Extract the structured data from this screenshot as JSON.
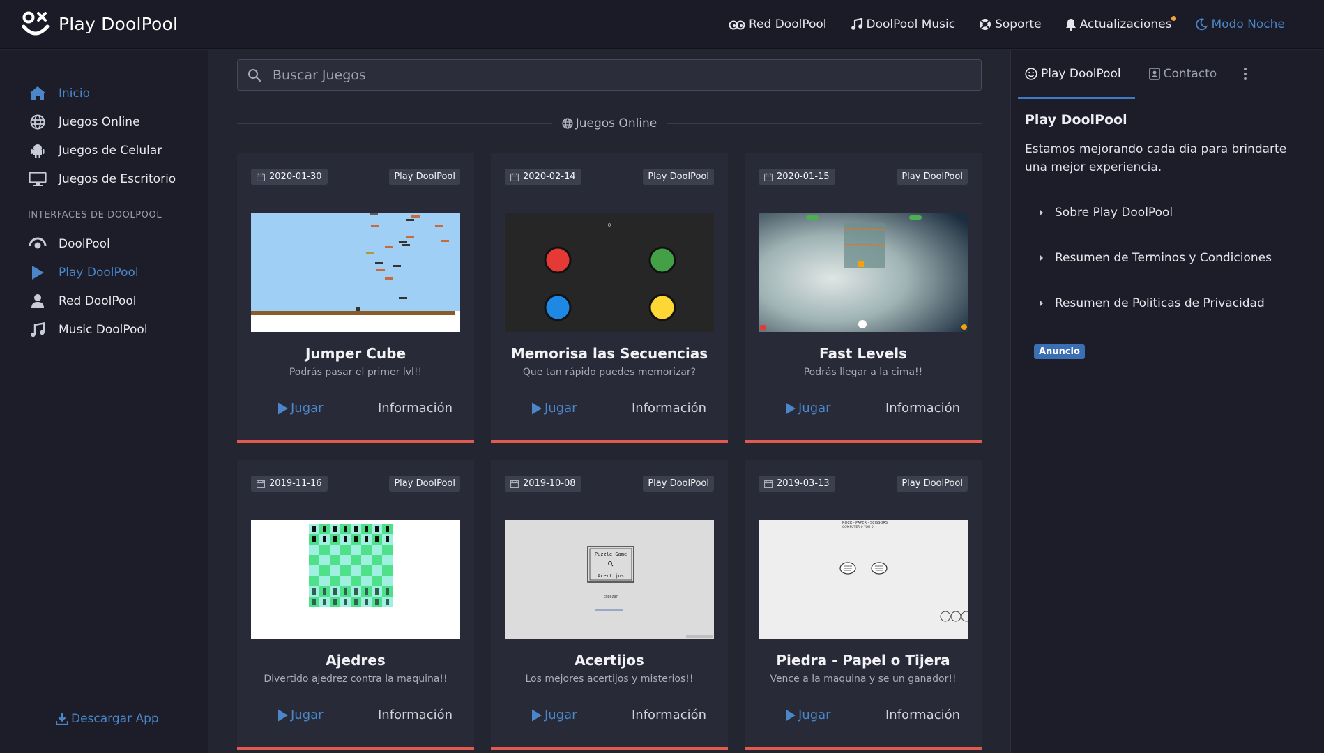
{
  "app": {
    "title": "Play DoolPool"
  },
  "topnav": {
    "items": [
      {
        "label": "Red DoolPool",
        "icon": "eyes-icon"
      },
      {
        "label": "DoolPool Music",
        "icon": "music-icon"
      },
      {
        "label": "Soporte",
        "icon": "support-icon"
      },
      {
        "label": "Actualizaciones",
        "icon": "bell-icon"
      },
      {
        "label": "Modo Noche",
        "icon": "moon-icon"
      }
    ]
  },
  "sidebar": {
    "items": [
      {
        "label": "Inicio",
        "icon": "home-icon",
        "active": true
      },
      {
        "label": "Juegos Online",
        "icon": "globe-icon"
      },
      {
        "label": "Juegos de Celular",
        "icon": "android-icon"
      },
      {
        "label": "Juegos de Escritorio",
        "icon": "desktop-icon"
      }
    ],
    "section_title": "INTERFACES DE DOOLPOOL",
    "interfaces": [
      {
        "label": "DoolPool",
        "icon": "eye-icon"
      },
      {
        "label": "Play DoolPool",
        "icon": "play-icon",
        "active": true
      },
      {
        "label": "Red DoolPool",
        "icon": "user-icon"
      },
      {
        "label": "Music DoolPool",
        "icon": "music-icon"
      }
    ],
    "download_label": "Descargar App"
  },
  "main": {
    "search_placeholder": "Buscar Juegos",
    "section_title": "Juegos Online",
    "play_label": "Jugar",
    "info_label": "Información",
    "cards": [
      {
        "date": "2020-01-30",
        "badge": "Play DoolPool",
        "title": "Jumper Cube",
        "desc": "Podrás pasar el primer lvl!!"
      },
      {
        "date": "2020-02-14",
        "badge": "Play DoolPool",
        "title": "Memorisa las Secuencias",
        "desc": "Que tan rápido puedes memorizar?"
      },
      {
        "date": "2020-01-15",
        "badge": "Play DoolPool",
        "title": "Fast Levels",
        "desc": "Podrás llegar a la cima!!"
      },
      {
        "date": "2019-11-16",
        "badge": "Play DoolPool",
        "title": "Ajedres",
        "desc": "Divertido ajedrez contra la maquina!!"
      },
      {
        "date": "2019-10-08",
        "badge": "Play DoolPool",
        "title": "Acertijos",
        "desc": "Los mejores acertijos y misterios!!"
      },
      {
        "date": "2019-03-13",
        "badge": "Play DoolPool",
        "title": "Piedra - Papel o Tijera",
        "desc": "Vence a la maquina y se un ganador!!"
      }
    ],
    "thumb_text": {
      "memorisa_counter": "0",
      "puzzle_title": "Puzzle Game",
      "puzzle_subtitle": "Acertijos",
      "puzzle_start": "Empezar",
      "rps_header": "ROCK - PAPER - SCISSORS",
      "rps_scores": "COMPUTER 0   YOU 0"
    }
  },
  "rpanel": {
    "tabs": [
      {
        "label": "Play DoolPool",
        "icon": "smile-icon",
        "active": true
      },
      {
        "label": "Contacto",
        "icon": "contact-icon"
      }
    ],
    "title": "Play DoolPool",
    "desc": "Estamos mejorando cada dia para brindarte una mejor experiencia.",
    "accordion": [
      "Sobre Play DoolPool",
      "Resumen de Terminos y Condiciones",
      "Resumen de Politicas de Privacidad"
    ],
    "ad_label": "Anuncio"
  },
  "colors": {
    "accent": "#4a86c8",
    "card_border": "#e05a4f",
    "notif": "#f2a33a"
  }
}
